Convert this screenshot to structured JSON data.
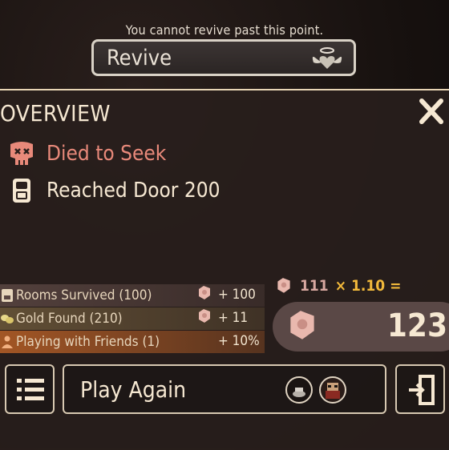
{
  "notice": "You cannot revive past this point.",
  "revive": {
    "label": "Revive",
    "icon": "winged-heart-icon"
  },
  "overview": {
    "title": "OVERVIEW",
    "died_label": "Died to Seek",
    "door_label": "Reached Door 200"
  },
  "bonuses": [
    {
      "label": "Rooms Survived (100)",
      "value": "+ 100",
      "icon": "door-icon"
    },
    {
      "label": "Gold Found (210)",
      "value": "+ 11",
      "icon": "gold-icon"
    },
    {
      "label": "Playing with Friends (1)",
      "value": "+ 10%",
      "icon": "friends-icon"
    }
  ],
  "knobs": {
    "base": "111",
    "multiplier": "× 1.10 =",
    "total": "123"
  },
  "buttons": {
    "play_again": "Play Again"
  },
  "colors": {
    "accent_gold": "#f2b93b",
    "death_red": "#e8897a",
    "panel_border": "#e8d5b5"
  }
}
